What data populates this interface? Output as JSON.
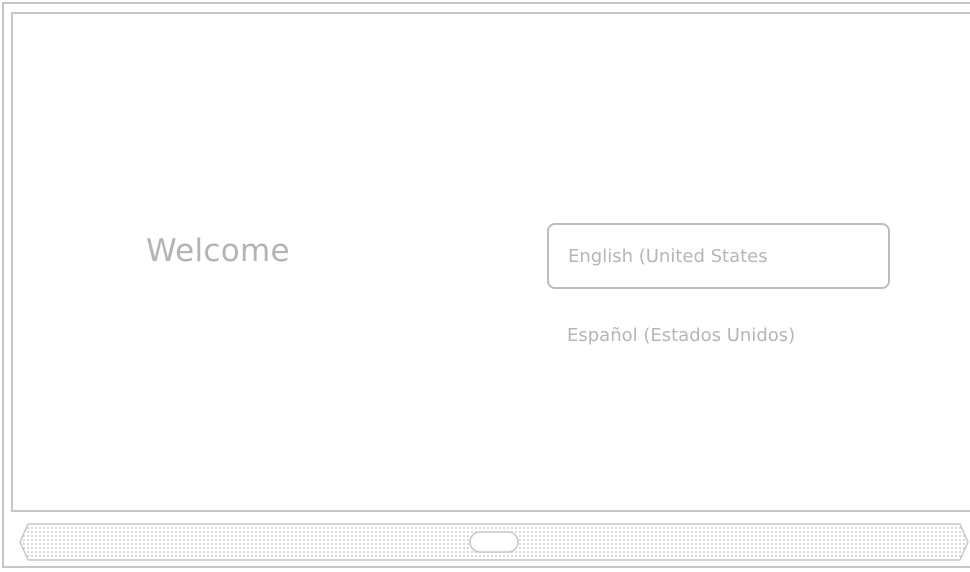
{
  "welcome": {
    "title": "Welcome"
  },
  "languages": {
    "selected": "English (United States",
    "other": "Español (Estados Unidos)"
  },
  "colors": {
    "frame": "#c7c7c7",
    "text": "#b4b4b4",
    "background": "#ffffff"
  }
}
